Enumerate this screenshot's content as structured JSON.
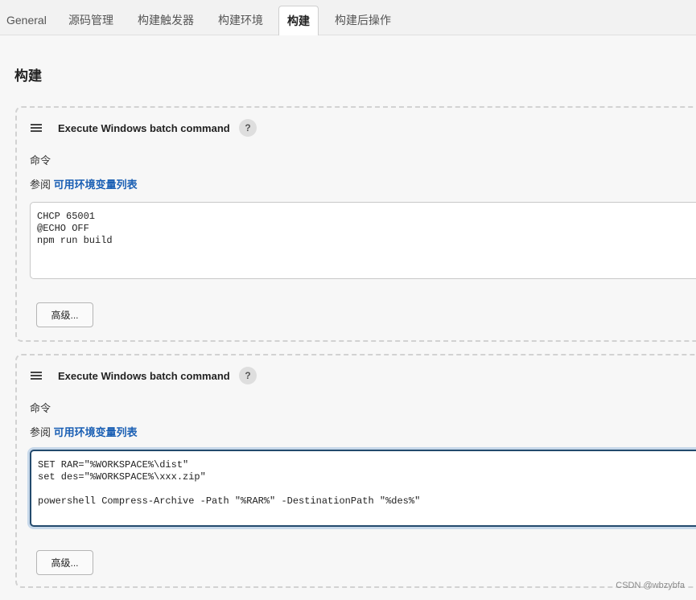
{
  "tabs": [
    {
      "label": "General"
    },
    {
      "label": "源码管理"
    },
    {
      "label": "构建触发器"
    },
    {
      "label": "构建环境"
    },
    {
      "label": "构建"
    },
    {
      "label": "构建后操作"
    }
  ],
  "active_tab": "构建",
  "section": {
    "title": "构建"
  },
  "steps": [
    {
      "title": "Execute Windows batch command",
      "help_label": "?",
      "field_label": "命令",
      "see_prefix": "参阅",
      "env_link": "可用环境变量列表",
      "command": "CHCP 65001\n@ECHO OFF\nnpm run build",
      "advanced_label": "高级..."
    },
    {
      "title": "Execute Windows batch command",
      "help_label": "?",
      "field_label": "命令",
      "see_prefix": "参阅",
      "env_link": "可用环境变量列表",
      "command": "SET RAR=\"%WORKSPACE%\\dist\"\nset des=\"%WORKSPACE%\\xxx.zip\"\n\npowershell Compress-Archive -Path \"%RAR%\" -DestinationPath \"%des%\"",
      "advanced_label": "高级..."
    }
  ],
  "watermark": "CSDN @wbzybfa",
  "colors": {
    "link": "#1a5fb4",
    "focus_border": "#234a6d",
    "focus_glow": "#c7d8ea"
  }
}
